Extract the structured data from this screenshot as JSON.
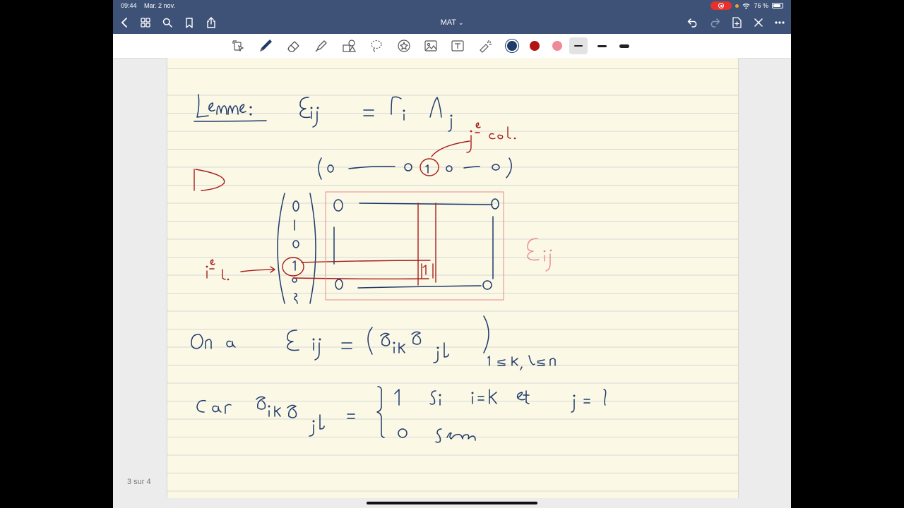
{
  "status_bar": {
    "time": "09:44",
    "date": "Mar. 2 nov.",
    "battery": "76 %"
  },
  "nav": {
    "title": "MAT",
    "title_chevron": "⌄"
  },
  "page": {
    "counter": "3 sur 4"
  },
  "colors": {
    "ink_blue": "#1f3a6b",
    "ink_red": "#a81e1e",
    "ink_pink": "#e68a92",
    "bar": "#3e5278",
    "paper": "#fbf8e6"
  },
  "tools": [
    "lasso-select",
    "pen",
    "eraser",
    "highlighter",
    "shapes",
    "lasso",
    "stickers",
    "image",
    "text",
    "laser-pointer"
  ],
  "note": {
    "lemma_label": "Lemme:",
    "lemma_eq": "Eij = Ci Lj",
    "col_label": "j^e col.",
    "proof_symbol": "D",
    "row_vector": "(0 —— 0 (1) 0 — 0)",
    "col_vector": [
      "0",
      "1",
      "0",
      "1",
      "0",
      "5"
    ],
    "row_label": "i^e l.",
    "matrix_zero": "0",
    "matrix_one": "1",
    "eij_label": "Eij",
    "on_a": "On a",
    "eij2": "Eij = (δik δjl)",
    "range": "1≤k, l≤n",
    "car": "Car",
    "delta": "δik δjl =",
    "case1": "1 si i=k et j=l",
    "case2": "0 sinon"
  }
}
